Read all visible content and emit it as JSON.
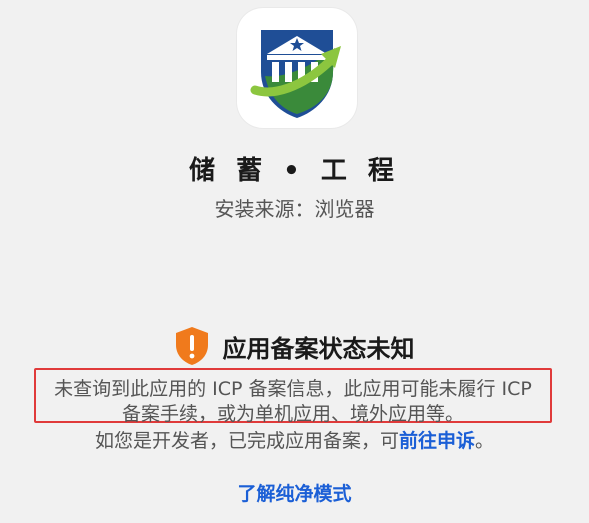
{
  "app": {
    "name": "储 蓄 • 工 程",
    "install_source": "安装来源：浏览器"
  },
  "status": {
    "title": "应用备案状态未知",
    "icon": "shield-exclamation-icon",
    "description_line1": "未查询到此应用的 ICP 备案信息，此应用可能未履行 ICP",
    "description_line2": "备案手续，或为单机应用、境外应用等。",
    "appeal_prefix": "如您是开发者，已完成应用备案，可",
    "appeal_link": "前往申诉",
    "appeal_suffix": "。"
  },
  "learn_more": "了解纯净模式",
  "colors": {
    "background": "#f1f1f1",
    "link": "#1b5fd6",
    "warning": "#f07a1c",
    "highlight_border": "#e03a3a"
  }
}
